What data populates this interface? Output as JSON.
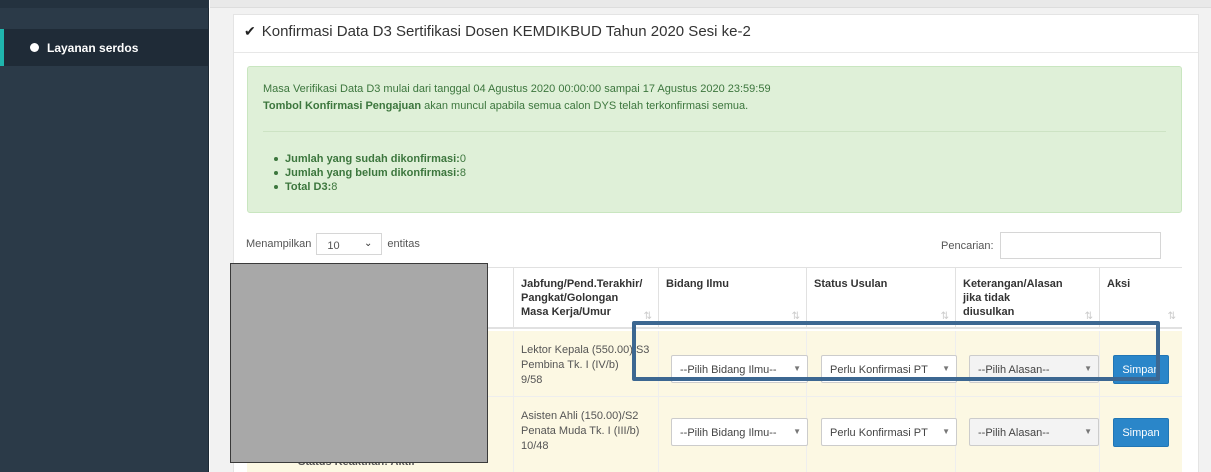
{
  "sidebar": {
    "items": [
      {
        "label": "Layanan serdos",
        "icon": "circle-icon"
      }
    ],
    "active_color": "#1fb5ad"
  },
  "panel": {
    "title": "Konfirmasi Data D3 Sertifikasi Dosen KEMDIKBUD Tahun 2020 Sesi ke-2",
    "title_icon": "check-icon"
  },
  "alert": {
    "line1": "Masa Verifikasi Data D3 mulai dari tanggal 04 Agustus 2020 00:00:00 sampai 17 Agustus 2020 23:59:59",
    "line2_bold": "Tombol Konfirmasi Pengajuan",
    "line2_rest": " akan muncul apabila semua calon DYS telah terkonfirmasi semua.",
    "stats": [
      {
        "label": "Jumlah yang sudah dikonfirmasi:",
        "value": " 0"
      },
      {
        "label": "Jumlah yang belum dikonfirmasi:",
        "value": " 8"
      },
      {
        "label": "Total D3:",
        "value": " 8"
      }
    ]
  },
  "table_controls": {
    "show_prefix": "Menampilkan",
    "page_size": "10",
    "show_suffix": "entitas",
    "search_label": "Pencarian:"
  },
  "table": {
    "columns": [
      {
        "line1": "Jabfung/Pend.Terakhir/",
        "line2": "Pangkat/Golongan",
        "line3": "Masa Kerja/Umur"
      },
      {
        "line1": "Bidang Ilmu"
      },
      {
        "line1": "Status Usulan"
      },
      {
        "line1": "Keterangan/Alasan",
        "line2": "jika tidak",
        "line3": "diusulkan"
      },
      {
        "line1": "Aksi"
      }
    ],
    "rows": [
      {
        "jab1": "Lektor Kepala (550.00)/S3",
        "jab2": "Pembina Tk. I (IV/b)",
        "jab3": "9/58",
        "bidang": "--Pilih Bidang Ilmu--",
        "status": "Perlu Konfirmasi PT",
        "alasan": "--Pilih Alasan--",
        "action": "Simpan"
      },
      {
        "jab1": "Asisten Ahli (150.00)/S2",
        "jab2": "Penata Muda Tk. I (III/b)",
        "jab3": "10/48",
        "bidang": "--Pilih Bidang Ilmu--",
        "status": "Perlu Konfirmasi PT",
        "alasan": "--Pilih Alasan--",
        "action": "Simpan"
      }
    ],
    "partial_text": "Status Keaktifan: Aktif"
  }
}
